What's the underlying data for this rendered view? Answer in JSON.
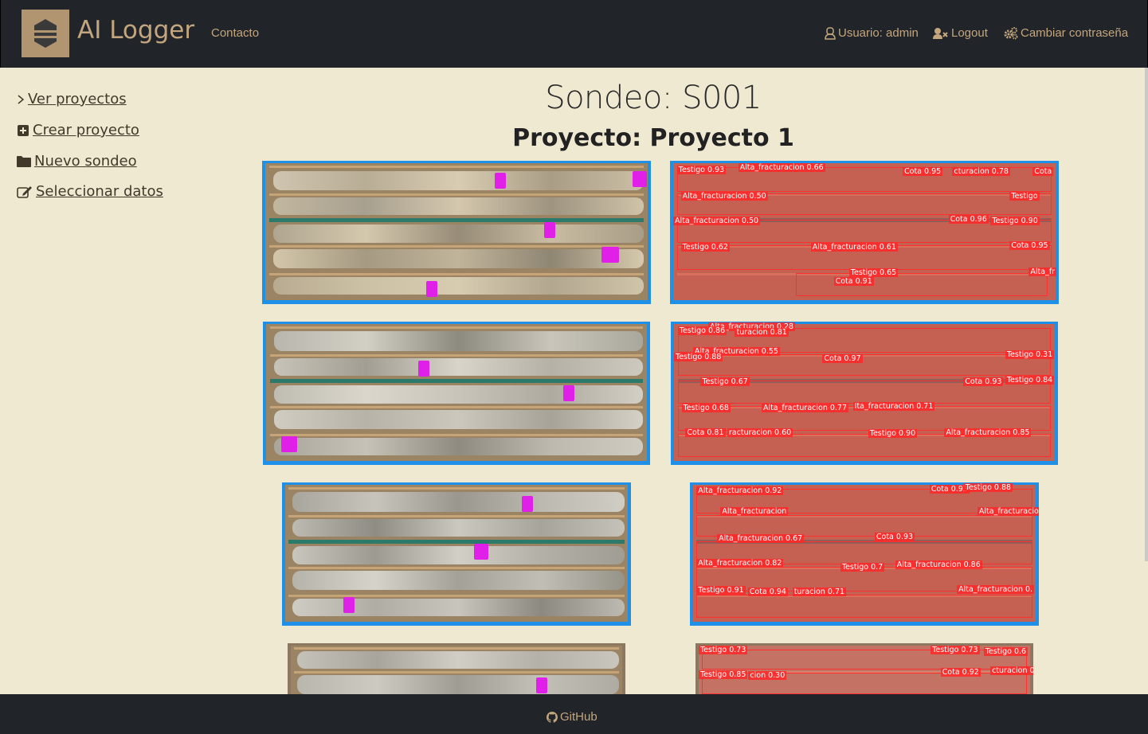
{
  "nav": {
    "brand": "AI Logger",
    "contact": "Contacto",
    "user": "Usuario: admin",
    "logout": "Logout",
    "change_password": "Cambiar contraseña"
  },
  "sidebar": {
    "items": [
      {
        "label": " Ver proyectos",
        "icon": "chevron-right-icon"
      },
      {
        "label": " Crear proyecto",
        "icon": "plus-square-icon"
      },
      {
        "label": " Nuevo sondeo",
        "icon": "folder-icon"
      },
      {
        "label": " Seleccionar datos",
        "icon": "edit-icon"
      }
    ]
  },
  "main": {
    "title": "Sondeo: S001",
    "subtitle": "Proyecto: Proyecto 1"
  },
  "detections": {
    "img1": [
      "Testigo 0.93",
      "Alta_fracturacion 0.66",
      "Cota 0.95",
      "cturacion 0.78",
      "Cota",
      "Alta_fracturacion 0.50",
      "Testigo",
      "Alta_fracturacion 0.50",
      "Cota 0.96",
      "Testigo 0.90",
      "Testigo 0.62",
      "Alta_fracturacion 0.61",
      "Cota 0.95",
      "Testigo 0.65",
      "Cota 0.91",
      "Alta_fr"
    ],
    "img2": [
      "Alta_fracturacion 0.28",
      "Testigo 0.86",
      "turacion 0.81",
      "Alta_fracturacion 0.55",
      "Testigo 0.88",
      "Cota 0.97",
      "Testigo 0.31",
      "Testigo 0.67",
      "Cota 0.93",
      "Testigo 0.84",
      "Testigo 0.68",
      "Alta_fracturacion 0.77",
      "Ita_fracturacion 0.71",
      "Cota 0.81",
      "racturacion 0.60",
      "Testigo 0.90",
      "Alta_fracturacion 0.85"
    ],
    "img3": [
      "Alta_fracturacion 0.92",
      "Cota 0.93",
      "Testigo 0.88",
      "Alta_fracturacion",
      "Alta_fracturacio",
      "Alta_fracturacion 0.67",
      "Cota 0.93",
      "Alta_fracturacion 0.82",
      "Testigo 0.7",
      "Alta_fracturacion 0.86",
      "Testigo 0.91",
      "Cota 0.94",
      "turacion 0.71",
      "Alta_fracturacion 0."
    ],
    "img4": [
      "Testigo 0.73",
      "Testigo 0.73",
      "Testigo 0.6",
      "Testigo 0.85",
      "cion 0.30",
      "Cota 0.92",
      "cturacion 0."
    ]
  },
  "footer": {
    "github": "GitHub"
  },
  "colors": {
    "navbar_bg": "#212529",
    "page_bg": "#f0e9d2",
    "accent": "#c4a67e",
    "tag_magenta": "#e020e8",
    "detection_red": "#ff3030"
  }
}
